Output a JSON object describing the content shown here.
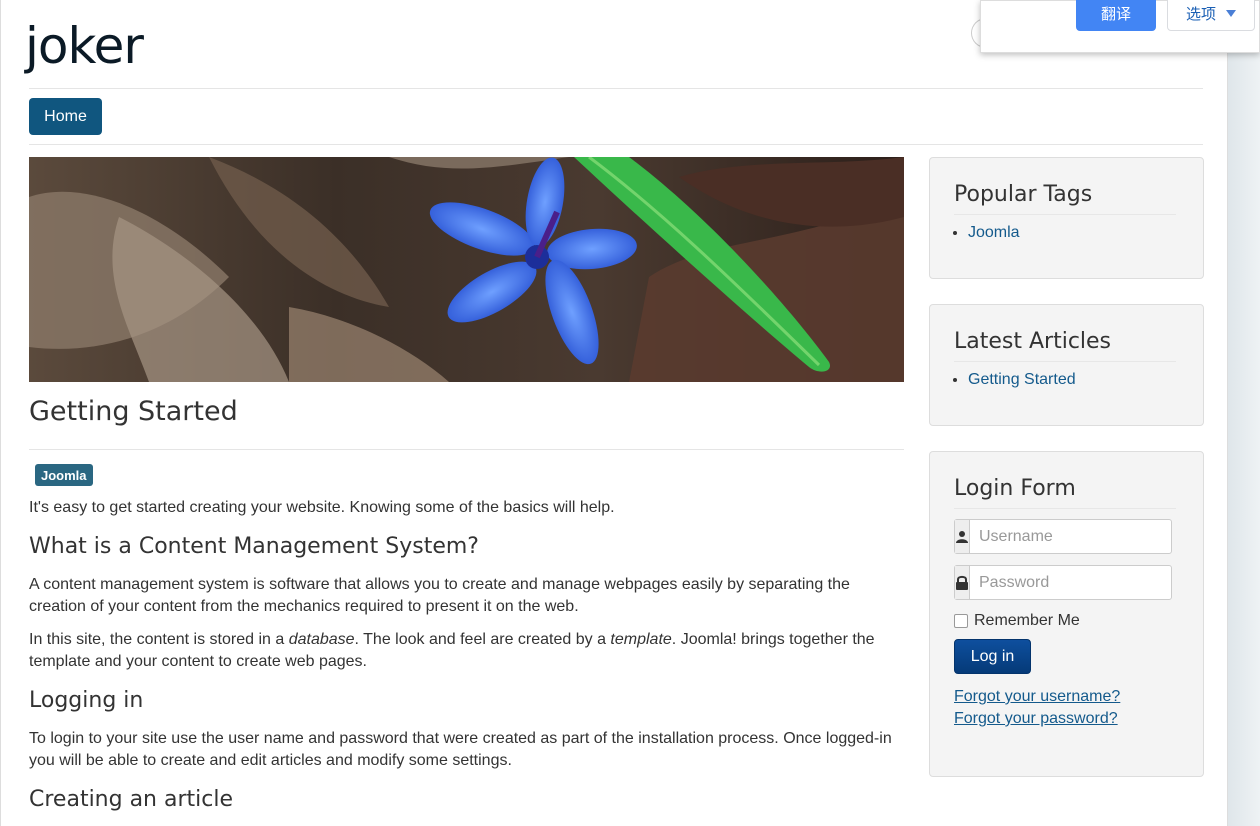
{
  "site": {
    "title": "joker"
  },
  "nav": {
    "home_label": "Home"
  },
  "article": {
    "title": "Getting Started",
    "tag": "Joomla",
    "intro": "It's easy to get started creating your website. Knowing some of the basics will help.",
    "h_cms": "What is a Content Management System?",
    "p_cms": "A content management system is software that allows you to create and manage webpages easily by separating the creation of your content from the mechanics required to present it on the web.",
    "p_site_1": "In this site, the content is stored in a ",
    "p_site_db": "database",
    "p_site_2": ". The look and feel are created by a ",
    "p_site_tpl": "template",
    "p_site_3": ". Joomla! brings together the template and your content to create web pages.",
    "h_login": "Logging in",
    "p_login": "To login to your site use the user name and password that were created as part of the installation process. Once logged-in you will be able to create and edit articles and modify some settings.",
    "h_create": "Creating an article"
  },
  "sidebar": {
    "popular_tags": {
      "title": "Popular Tags",
      "items": [
        "Joomla"
      ]
    },
    "latest_articles": {
      "title": "Latest Articles",
      "items": [
        "Getting Started"
      ]
    },
    "login": {
      "title": "Login Form",
      "username_placeholder": "Username",
      "password_placeholder": "Password",
      "remember_label": "Remember Me",
      "login_button": "Log in",
      "forgot_username": "Forgot your username?",
      "forgot_password": "Forgot your password?"
    }
  },
  "translate_bar": {
    "translate_label": "翻译",
    "options_label": "选项"
  },
  "colors": {
    "nav_blue": "#10567f",
    "badge": "#2a6782",
    "login_button": "#0e4f9e",
    "link": "#145a8c",
    "translate_blue": "#4285f4"
  }
}
